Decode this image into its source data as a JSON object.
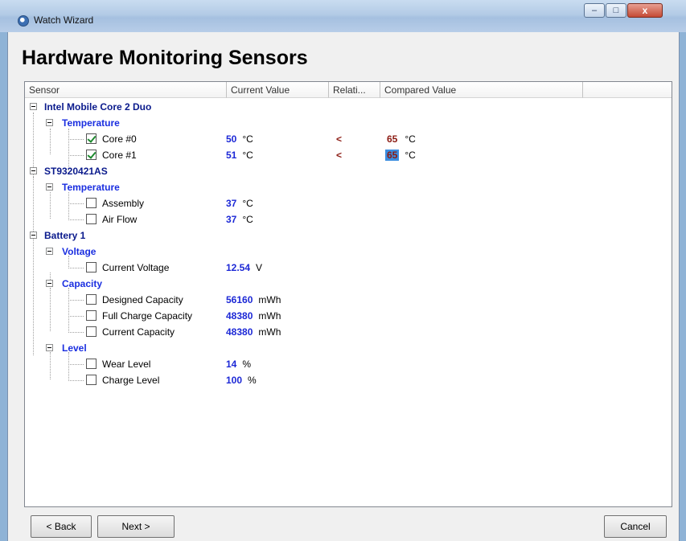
{
  "window": {
    "title": "Watch Wizard"
  },
  "titlebar_buttons": {
    "minimize": "–",
    "maximize": "□",
    "close": "x"
  },
  "page": {
    "heading": "Hardware Monitoring Sensors"
  },
  "columns": [
    "Sensor",
    "Current Value",
    "Relati...",
    "Compared Value",
    ""
  ],
  "tree": {
    "dev1": {
      "name": "Intel Mobile Core 2 Duo",
      "groups": {
        "temperature": {
          "name": "Temperature",
          "sensors": [
            {
              "name": "Core #0",
              "checked": true,
              "value": "50",
              "unit": "°C",
              "relation": "<",
              "compared": "65",
              "compared_unit": "°C"
            },
            {
              "name": "Core #1",
              "checked": true,
              "value": "51",
              "unit": "°C",
              "relation": "<",
              "compared": "65",
              "compared_unit": "°C"
            }
          ]
        }
      }
    },
    "dev2": {
      "name": "ST9320421AS",
      "groups": {
        "temperature": {
          "name": "Temperature",
          "sensors": [
            {
              "name": "Assembly",
              "checked": false,
              "value": "37",
              "unit": "°C"
            },
            {
              "name": "Air Flow",
              "checked": false,
              "value": "37",
              "unit": "°C"
            }
          ]
        }
      }
    },
    "dev3": {
      "name": "Battery 1",
      "groups": {
        "voltage": {
          "name": "Voltage",
          "sensors": [
            {
              "name": "Current Voltage",
              "checked": false,
              "value": "12.54",
              "unit": "V"
            }
          ]
        },
        "capacity": {
          "name": "Capacity",
          "sensors": [
            {
              "name": "Designed Capacity",
              "checked": false,
              "value": "56160",
              "unit": "mWh"
            },
            {
              "name": "Full Charge Capacity",
              "checked": false,
              "value": "48380",
              "unit": "mWh"
            },
            {
              "name": "Current Capacity",
              "checked": false,
              "value": "48380",
              "unit": "mWh"
            }
          ]
        },
        "level": {
          "name": "Level",
          "sensors": [
            {
              "name": "Wear Level",
              "checked": false,
              "value": "14",
              "unit": "%"
            },
            {
              "name": "Charge Level",
              "checked": false,
              "value": "100",
              "unit": "%"
            }
          ]
        }
      }
    }
  },
  "buttons": {
    "back": "< Back",
    "next": "Next >",
    "cancel": "Cancel"
  }
}
